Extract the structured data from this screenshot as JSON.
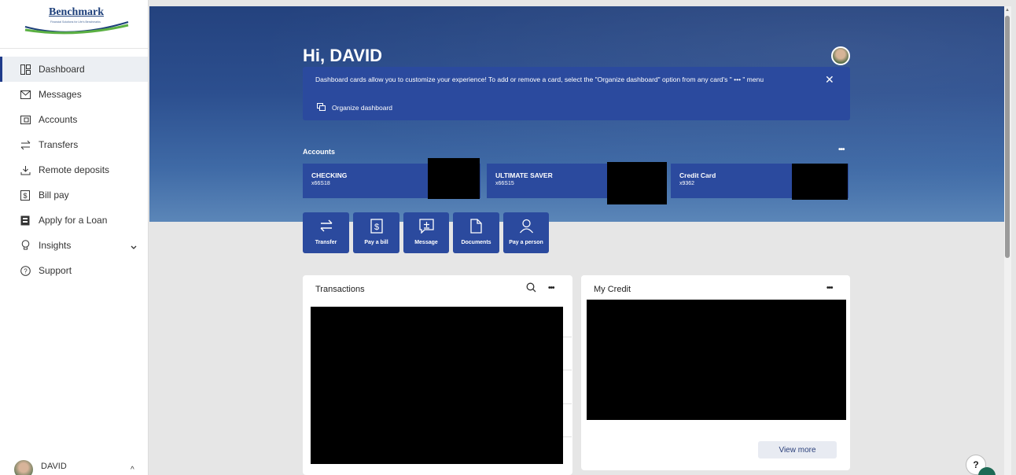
{
  "brand": {
    "name": "Benchmark",
    "tagline": "Financial Solutions for Life's Benchmarks"
  },
  "sidebar": {
    "items": [
      {
        "label": "Dashboard",
        "icon": "dashboard-icon",
        "active": true
      },
      {
        "label": "Messages",
        "icon": "mail-icon"
      },
      {
        "label": "Accounts",
        "icon": "accounts-icon"
      },
      {
        "label": "Transfers",
        "icon": "transfer-icon"
      },
      {
        "label": "Remote deposits",
        "icon": "deposit-icon"
      },
      {
        "label": "Bill pay",
        "icon": "bill-icon"
      },
      {
        "label": "Apply for a Loan",
        "icon": "loan-icon"
      },
      {
        "label": "Insights",
        "icon": "lightbulb-icon"
      },
      {
        "label": "Support",
        "icon": "help-circle-icon"
      }
    ],
    "user": "DAVID"
  },
  "header": {
    "greeting": "Hi, DAVID",
    "info_message": "Dashboard cards allow you to customize your experience! To add or remove a card, select the \"Organize dashboard\" option from any card's \" ••• \" menu",
    "organize_label": "Organize dashboard"
  },
  "accounts": {
    "title": "Accounts",
    "more": "•••",
    "cards": [
      {
        "name": "CHECKING",
        "number": "x66S18"
      },
      {
        "name": "ULTIMATE SAVER",
        "number": "x66S15"
      },
      {
        "name": "Credit Card",
        "number": "x9362"
      }
    ]
  },
  "quick_actions": [
    {
      "label": "Transfer",
      "icon": "transfer-icon"
    },
    {
      "label": "Pay a bill",
      "icon": "bill-icon"
    },
    {
      "label": "Message",
      "icon": "message-icon"
    },
    {
      "label": "Documents",
      "icon": "document-icon"
    },
    {
      "label": "Pay a person",
      "icon": "person-icon"
    }
  ],
  "transactions": {
    "title": "Transactions",
    "more": "•••"
  },
  "my_credit": {
    "title": "My Credit",
    "more": "•••",
    "view_more": "View more"
  },
  "help": {
    "label": "?"
  },
  "colors": {
    "primary": "#2b4a9e",
    "banner": "#2c4f8f",
    "background": "#e6e6e6"
  }
}
